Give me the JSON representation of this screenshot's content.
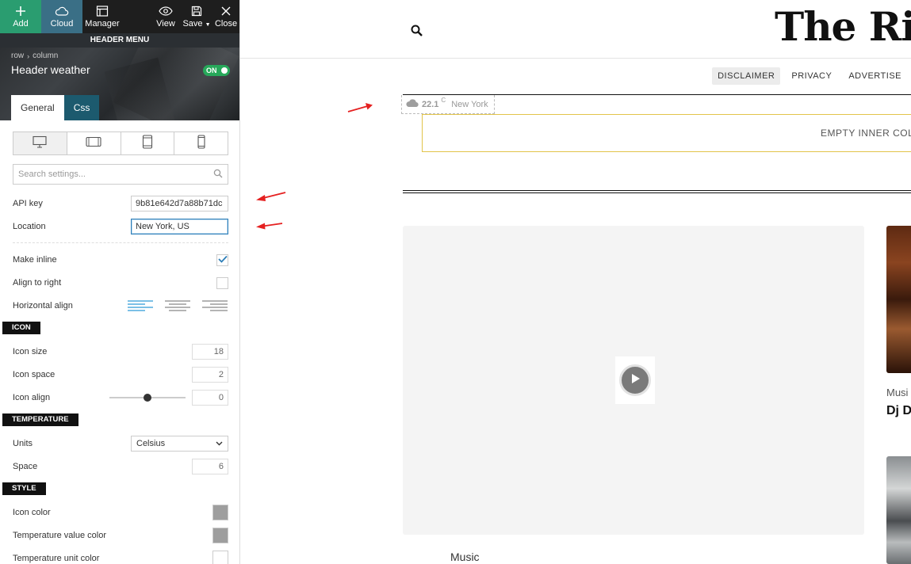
{
  "toolbar": {
    "add": "Add",
    "cloud": "Cloud",
    "manager": "Manager",
    "view": "View",
    "save": "Save",
    "close": "Close"
  },
  "subbar": "HEADER MENU",
  "breadcrumb": {
    "first": "row",
    "second": "column"
  },
  "element_title": "Header weather",
  "toggle": "ON",
  "tabs": {
    "general": "General",
    "css": "Css"
  },
  "search": {
    "placeholder": "Search settings..."
  },
  "fields": {
    "api_key": {
      "label": "API key",
      "value": "9b81e642d7a88b71dc"
    },
    "location": {
      "label": "Location",
      "value": "New York, US"
    },
    "make_inline": {
      "label": "Make inline",
      "checked": true
    },
    "align_right": {
      "label": "Align to right",
      "checked": false
    },
    "horizontal_align": {
      "label": "Horizontal align"
    }
  },
  "sections": {
    "icon": "ICON",
    "temperature": "TEMPERATURE",
    "style": "STYLE"
  },
  "icon": {
    "size": {
      "label": "Icon size",
      "value": "18"
    },
    "space": {
      "label": "Icon space",
      "value": "2"
    },
    "align": {
      "label": "Icon align",
      "value": "0"
    }
  },
  "temperature": {
    "units": {
      "label": "Units",
      "value": "Celsius"
    },
    "space": {
      "label": "Space",
      "value": "6"
    }
  },
  "style": {
    "icon_color": {
      "label": "Icon color",
      "color": "#9e9e9e"
    },
    "temp_value_color": {
      "label": "Temperature value color",
      "color": "#9e9e9e"
    },
    "temp_unit_color": {
      "label": "Temperature unit color",
      "color": "#ffffff"
    }
  },
  "site": {
    "logo": "The Rin",
    "nav": [
      "DISCLAIMER",
      "PRIVACY",
      "ADVERTISE"
    ],
    "weather": {
      "value": "22.1",
      "unit": "C",
      "location": "New York"
    },
    "empty_column": "EMPTY INNER COLU",
    "card_label": "Music",
    "side_label": "Musi",
    "side_title": "Dj D"
  },
  "colors": {
    "accent_green": "#2a9d70",
    "accent_teal": "#3a6f86",
    "focus_blue": "#2d7eb8",
    "empty_column_border": "#e2c44a"
  }
}
